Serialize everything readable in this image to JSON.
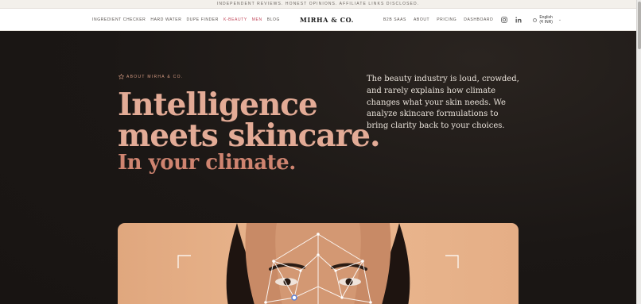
{
  "announcement": "INDEPENDENT REVIEWS. HONEST OPINIONS. AFFILIATE LINKS DISCLOSED.",
  "nav": {
    "left": [
      {
        "label": "INGREDIENT CHECKER"
      },
      {
        "label": "HARD WATER"
      },
      {
        "label": "DUPE FINDER"
      },
      {
        "label": "K-BEAUTY"
      },
      {
        "label": "MEN"
      },
      {
        "label": "BLOG"
      }
    ],
    "logo": "MIRHA & CO.",
    "right": [
      {
        "label": "B2B SAAS"
      },
      {
        "label": "ABOUT"
      },
      {
        "label": "PRICING"
      },
      {
        "label": "DASHBOARD"
      }
    ],
    "language": {
      "line1": "English",
      "line2": "(₹ INR)"
    }
  },
  "hero": {
    "eyebrow": "ABOUT MIRHA & CO.",
    "title_line1": "Intelligence",
    "title_line2": "meets skincare.",
    "title_line3": "In your climate.",
    "lede": "The beauty industry is loud, crowded, and rarely explains how climate changes what your skin needs. We analyze skincare formulations to bring clarity back to your choices."
  },
  "colors": {
    "accent": "#c0475a",
    "heading": "#e3ab96",
    "subheading": "#cf8470",
    "background": "#1b1715"
  },
  "icons": [
    "star-outline-icon",
    "instagram-icon",
    "linkedin-icon",
    "globe-icon",
    "chevron-down-icon"
  ]
}
